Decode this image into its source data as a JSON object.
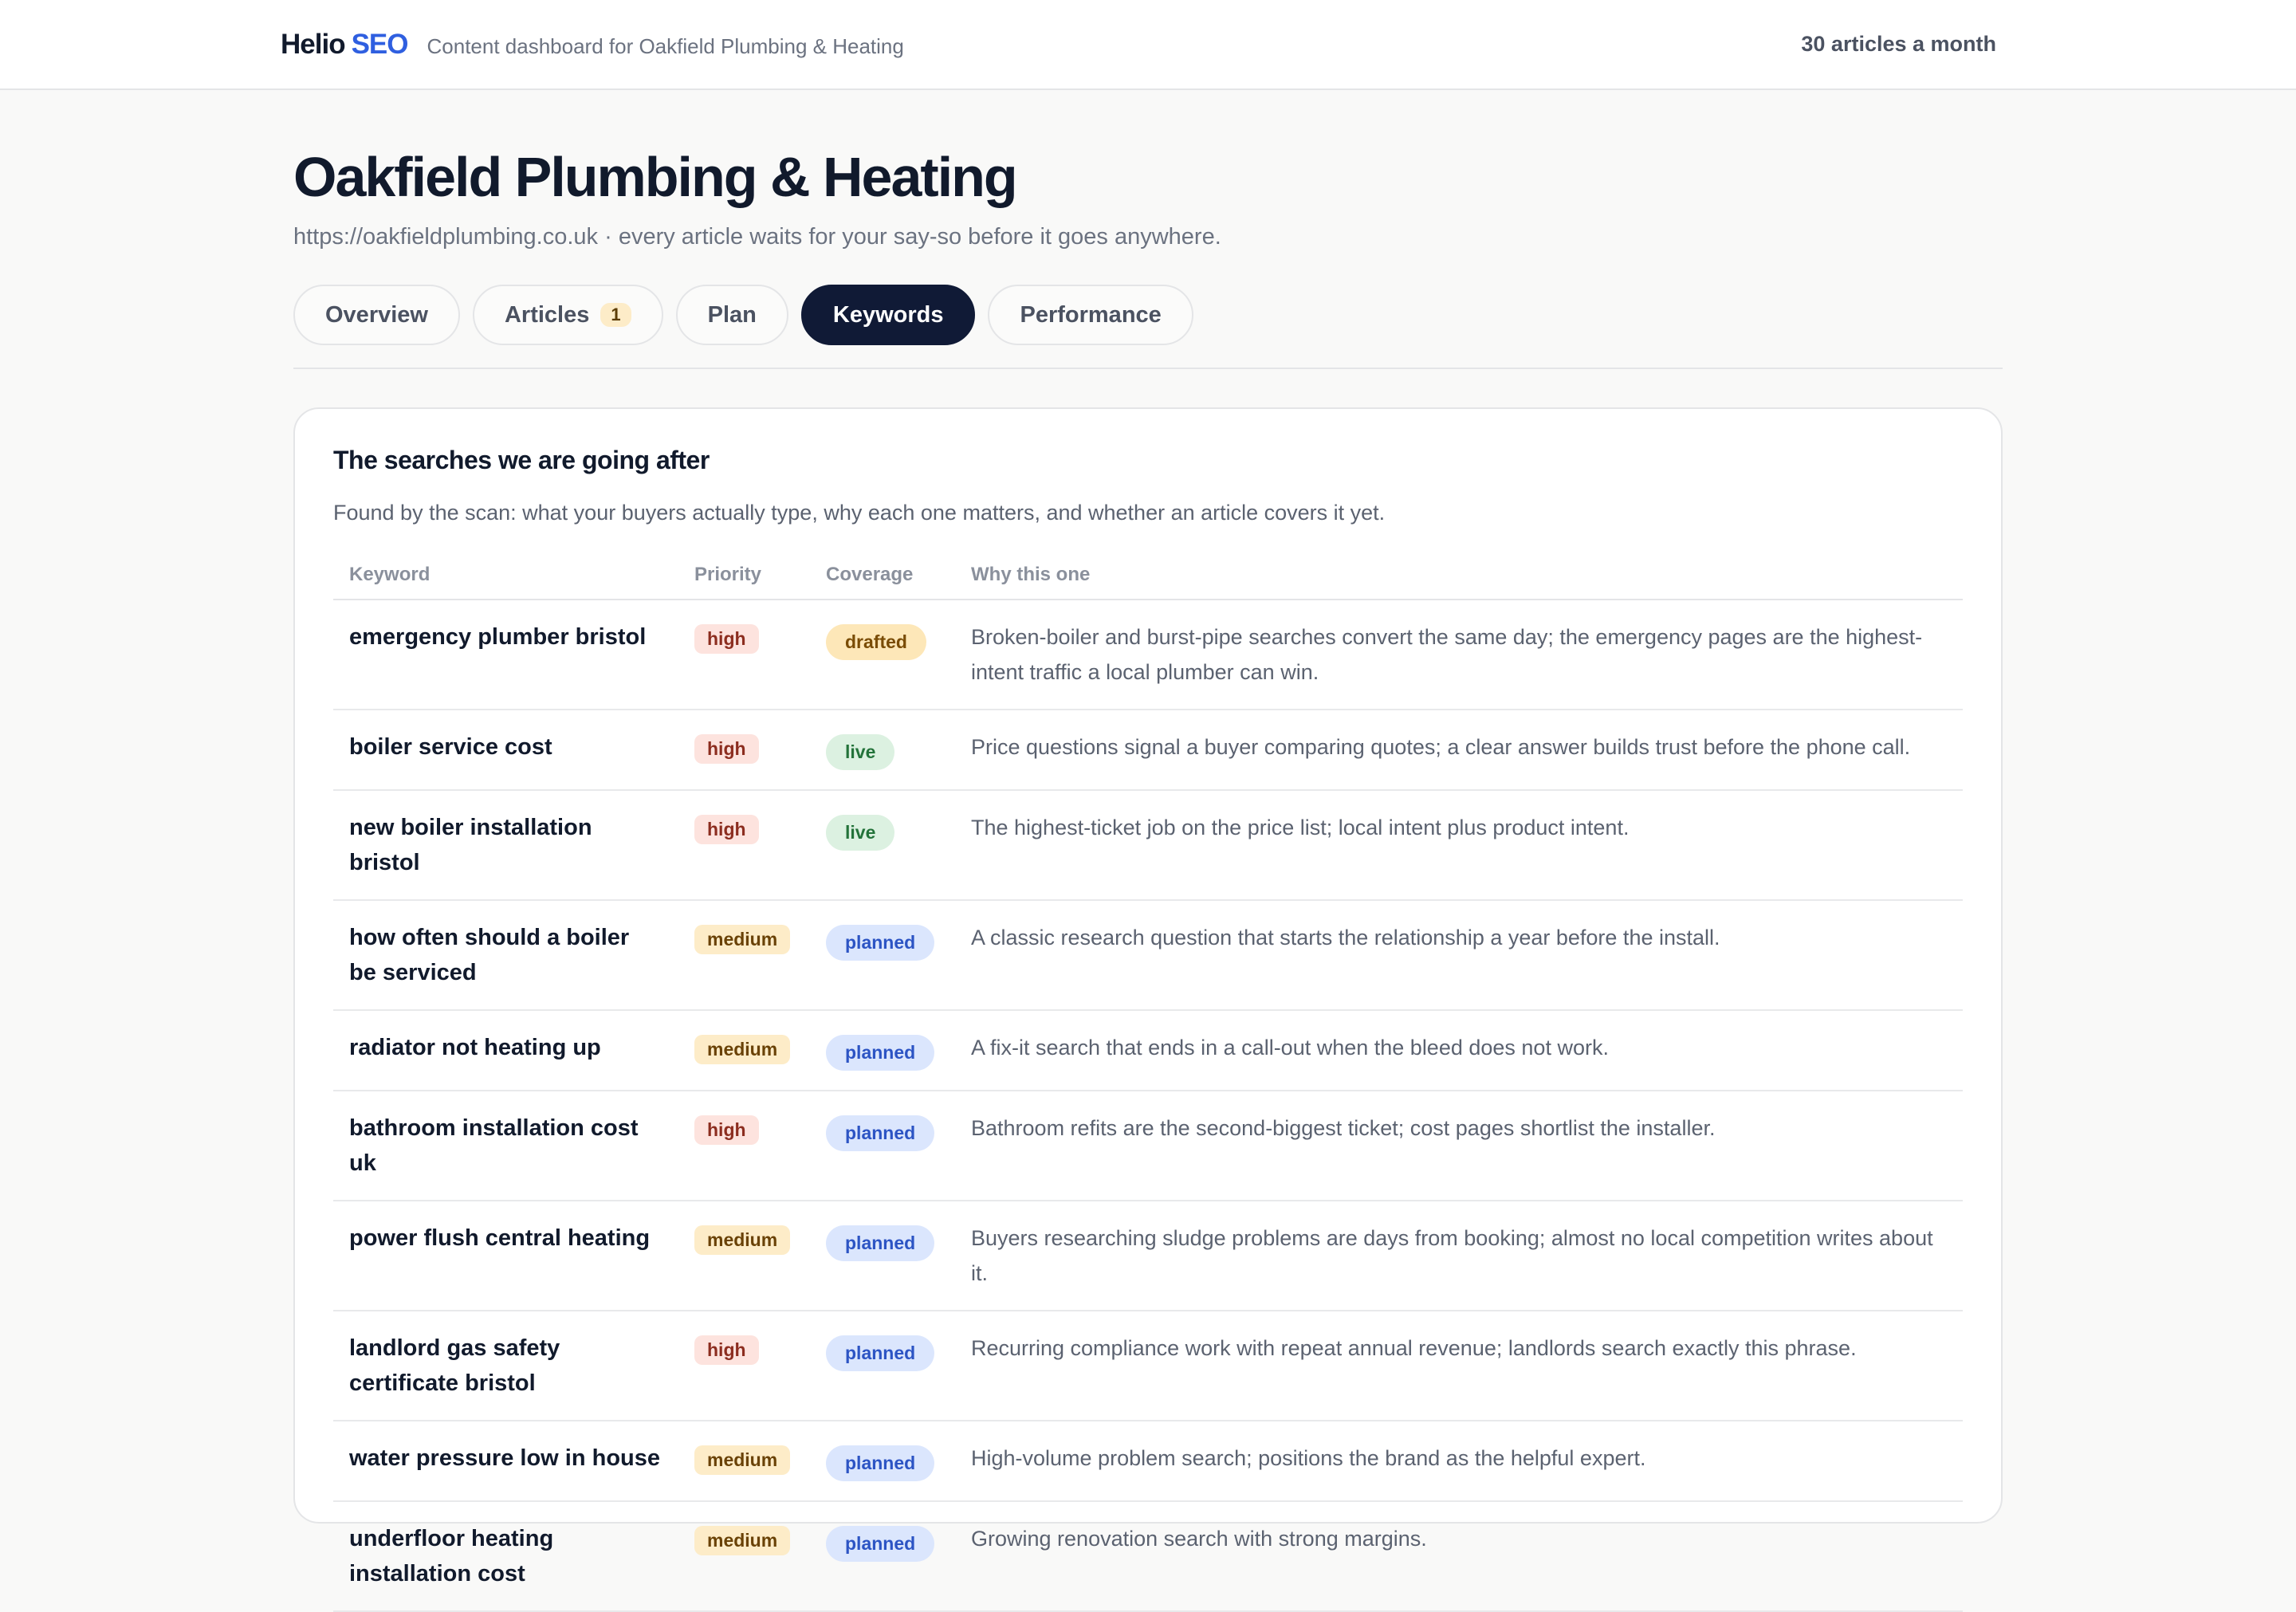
{
  "header": {
    "logo_primary": "Helio",
    "logo_accent": "SEO",
    "subtitle": "Content dashboard for Oakfield Plumbing & Heating",
    "plan": "30 articles a month"
  },
  "page": {
    "title": "Oakfield Plumbing & Heating",
    "subtitle": "https://oakfieldplumbing.co.uk · every article waits for your say-so before it goes anywhere."
  },
  "tabs": [
    {
      "label": "Overview"
    },
    {
      "label": "Articles",
      "count": "1"
    },
    {
      "label": "Plan"
    },
    {
      "label": "Keywords",
      "active": true
    },
    {
      "label": "Performance"
    }
  ],
  "keywords": {
    "title": "The searches we are going after",
    "description": "Found by the scan: what your buyers actually type, why each one matters, and whether an article covers it yet.",
    "columns": [
      "Keyword",
      "Priority",
      "Coverage",
      "Why this one"
    ],
    "rows": [
      {
        "keyword": "emergency plumber bristol",
        "priority": "high",
        "coverage": "drafted",
        "why": "Broken-boiler and burst-pipe searches convert the same day; the emergency pages are the highest-intent traffic a local plumber can win."
      },
      {
        "keyword": "boiler service cost",
        "priority": "high",
        "coverage": "live",
        "why": "Price questions signal a buyer comparing quotes; a clear answer builds trust before the phone call."
      },
      {
        "keyword": "new boiler installation bristol",
        "priority": "high",
        "coverage": "live",
        "why": "The highest-ticket job on the price list; local intent plus product intent."
      },
      {
        "keyword": "how often should a boiler be serviced",
        "priority": "medium",
        "coverage": "planned",
        "why": "A classic research question that starts the relationship a year before the install."
      },
      {
        "keyword": "radiator not heating up",
        "priority": "medium",
        "coverage": "planned",
        "why": "A fix-it search that ends in a call-out when the bleed does not work."
      },
      {
        "keyword": "bathroom installation cost uk",
        "priority": "high",
        "coverage": "planned",
        "why": "Bathroom refits are the second-biggest ticket; cost pages shortlist the installer."
      },
      {
        "keyword": "power flush central heating",
        "priority": "medium",
        "coverage": "planned",
        "why": "Buyers researching sludge problems are days from booking; almost no local competition writes about it."
      },
      {
        "keyword": "landlord gas safety certificate bristol",
        "priority": "high",
        "coverage": "planned",
        "why": "Recurring compliance work with repeat annual revenue; landlords search exactly this phrase."
      },
      {
        "keyword": "water pressure low in house",
        "priority": "medium",
        "coverage": "planned",
        "why": "High-volume problem search; positions the brand as the helpful expert."
      },
      {
        "keyword": "underfloor heating installation cost",
        "priority": "medium",
        "coverage": "planned",
        "why": "Growing renovation search with strong margins."
      }
    ]
  }
}
